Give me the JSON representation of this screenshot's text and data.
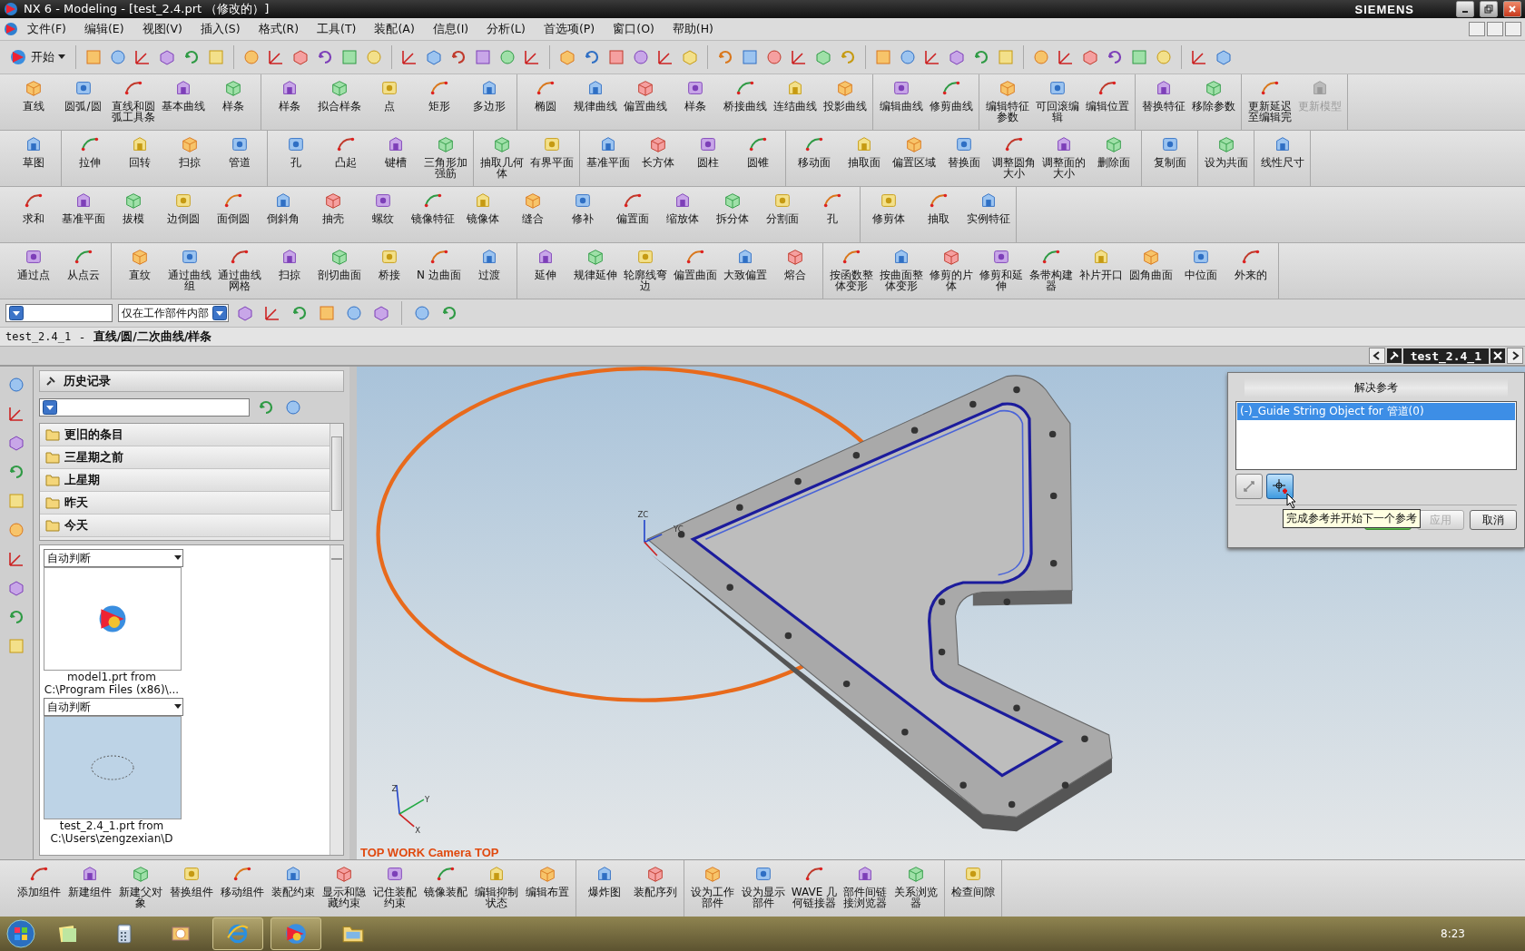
{
  "title_bar": {
    "title": "NX 6 - Modeling - [test_2.4.prt （修改的）]",
    "brand": "SIEMENS"
  },
  "menu": [
    "文件(F)",
    "编辑(E)",
    "视图(V)",
    "插入(S)",
    "格式(R)",
    "工具(T)",
    "装配(A)",
    "信息(I)",
    "分析(L)",
    "首选项(P)",
    "窗口(O)",
    "帮助(H)"
  ],
  "start_button": {
    "label": "开始"
  },
  "ribbon_rows": [
    [
      [
        {
          "label": "直线",
          "disabled": false
        },
        {
          "label": "圆弧/圆",
          "disabled": false
        },
        {
          "label": "直线和圆弧工具条",
          "disabled": false
        },
        {
          "label": "基本曲线",
          "disabled": false
        },
        {
          "label": "样条",
          "disabled": false
        }
      ],
      [
        {
          "label": "样条",
          "disabled": false
        },
        {
          "label": "拟合样条",
          "disabled": false
        },
        {
          "label": "点",
          "disabled": false
        },
        {
          "label": "矩形",
          "disabled": false
        },
        {
          "label": "多边形",
          "disabled": false
        }
      ],
      [
        {
          "label": "椭圆",
          "disabled": false
        },
        {
          "label": "规律曲线",
          "disabled": false
        },
        {
          "label": "偏置曲线",
          "disabled": false
        },
        {
          "label": "样条",
          "disabled": false
        },
        {
          "label": "桥接曲线",
          "disabled": false
        },
        {
          "label": "连结曲线",
          "disabled": false
        },
        {
          "label": "投影曲线",
          "disabled": false
        }
      ],
      [
        {
          "label": "编辑曲线",
          "disabled": false
        },
        {
          "label": "修剪曲线",
          "disabled": false
        }
      ],
      [
        {
          "label": "编辑特征参数",
          "disabled": false
        },
        {
          "label": "可回滚编辑",
          "disabled": false
        },
        {
          "label": "编辑位置",
          "disabled": false
        }
      ],
      [
        {
          "label": "替换特征",
          "disabled": false
        },
        {
          "label": "移除参数",
          "disabled": false
        }
      ],
      [
        {
          "label": "更新延迟至编辑完",
          "disabled": false
        },
        {
          "label": "更新模型",
          "disabled": true
        }
      ]
    ],
    [
      [
        {
          "label": "草图",
          "disabled": false
        }
      ],
      [
        {
          "label": "拉伸",
          "disabled": false
        },
        {
          "label": "回转",
          "disabled": false
        },
        {
          "label": "扫掠",
          "disabled": false
        },
        {
          "label": "管道",
          "disabled": false
        }
      ],
      [
        {
          "label": "孔",
          "disabled": false
        },
        {
          "label": "凸起",
          "disabled": false
        },
        {
          "label": "键槽",
          "disabled": false
        },
        {
          "label": "三角形加强筋",
          "disabled": false
        }
      ],
      [
        {
          "label": "抽取几何体",
          "disabled": false
        },
        {
          "label": "有界平面",
          "disabled": false
        }
      ],
      [
        {
          "label": "基准平面",
          "disabled": false
        },
        {
          "label": "长方体",
          "disabled": false
        },
        {
          "label": "圆柱",
          "disabled": false
        },
        {
          "label": "圆锥",
          "disabled": false
        }
      ],
      [
        {
          "label": "移动面",
          "disabled": false
        },
        {
          "label": "抽取面",
          "disabled": false
        },
        {
          "label": "偏置区域",
          "disabled": false
        },
        {
          "label": "替换面",
          "disabled": false
        },
        {
          "label": "调整圆角大小",
          "disabled": false
        },
        {
          "label": "调整面的大小",
          "disabled": false
        },
        {
          "label": "删除面",
          "disabled": false
        }
      ],
      [
        {
          "label": "复制面",
          "disabled": false
        }
      ],
      [
        {
          "label": "设为共面",
          "disabled": false
        }
      ],
      [
        {
          "label": "线性尺寸",
          "disabled": false
        }
      ]
    ],
    [
      [
        {
          "label": "求和",
          "disabled": false
        },
        {
          "label": "基准平面",
          "disabled": false
        },
        {
          "label": "拔模",
          "disabled": false
        },
        {
          "label": "边倒圆",
          "disabled": false
        },
        {
          "label": "面倒圆",
          "disabled": false
        },
        {
          "label": "倒斜角",
          "disabled": false
        },
        {
          "label": "抽壳",
          "disabled": false
        },
        {
          "label": "螺纹",
          "disabled": false
        },
        {
          "label": "镜像特征",
          "disabled": false
        },
        {
          "label": "镜像体",
          "disabled": false
        },
        {
          "label": "缝合",
          "disabled": false
        },
        {
          "label": "修补",
          "disabled": false
        },
        {
          "label": "偏置面",
          "disabled": false
        },
        {
          "label": "缩放体",
          "disabled": false
        },
        {
          "label": "拆分体",
          "disabled": false
        },
        {
          "label": "分割面",
          "disabled": false
        },
        {
          "label": "孔",
          "disabled": false
        }
      ],
      [
        {
          "label": "修剪体",
          "disabled": false
        },
        {
          "label": "抽取",
          "disabled": false
        },
        {
          "label": "实例特征",
          "disabled": false
        }
      ]
    ],
    [
      [
        {
          "label": "通过点",
          "disabled": false
        },
        {
          "label": "从点云",
          "disabled": false
        }
      ],
      [
        {
          "label": "直纹",
          "disabled": false
        },
        {
          "label": "通过曲线组",
          "disabled": false
        },
        {
          "label": "通过曲线网格",
          "disabled": false
        },
        {
          "label": "扫掠",
          "disabled": false
        },
        {
          "label": "剖切曲面",
          "disabled": false
        },
        {
          "label": "桥接",
          "disabled": false
        },
        {
          "label": "N 边曲面",
          "disabled": false
        },
        {
          "label": "过渡",
          "disabled": false
        }
      ],
      [
        {
          "label": "延伸",
          "disabled": false
        },
        {
          "label": "规律延伸",
          "disabled": false
        },
        {
          "label": "轮廓线弯边",
          "disabled": false
        },
        {
          "label": "偏置曲面",
          "disabled": false
        },
        {
          "label": "大致偏置",
          "disabled": false
        },
        {
          "label": "熔合",
          "disabled": false
        }
      ],
      [
        {
          "label": "按函数整体变形",
          "disabled": false
        },
        {
          "label": "按曲面整体变形",
          "disabled": false
        },
        {
          "label": "修剪的片体",
          "disabled": false
        },
        {
          "label": "修剪和延伸",
          "disabled": false
        },
        {
          "label": "条带构建器",
          "disabled": false
        },
        {
          "label": "补片开口",
          "disabled": false
        },
        {
          "label": "圆角曲面",
          "disabled": false
        },
        {
          "label": "中位面",
          "disabled": false
        },
        {
          "label": "外来的",
          "disabled": false
        }
      ]
    ]
  ],
  "selection_bar": {
    "scope": "仅在工作部件内部"
  },
  "cue_line": {
    "part": "test_2.4_1",
    "separator": "-",
    "prompt": "直线/圆/二次曲线/样条"
  },
  "window_tab": {
    "label": "test_2.4_1"
  },
  "navigator": {
    "title": "历史记录",
    "groups": [
      "更旧的条目",
      "三星期之前",
      "上星期",
      "昨天",
      "今天"
    ],
    "previews": [
      {
        "mode": "自动判断",
        "kind": "logo",
        "file": "model1.prt from",
        "path": "C:\\Program Files (x86)\\..."
      },
      {
        "mode": "自动判断",
        "kind": "sketch",
        "file": "test_2.4_1.prt from",
        "path": "C:\\Users\\zengzexian\\D"
      }
    ]
  },
  "graphics": {
    "view_label": "TOP WORK Camera TOP",
    "wcs_labels": [
      "ZC",
      "YC"
    ],
    "triad_labels": [
      "Z",
      "Y",
      "X"
    ]
  },
  "dialog": {
    "title": "解决参考",
    "items": [
      {
        "label": "(-)_Guide String Object for 管道(0)",
        "selected": true
      }
    ],
    "tools": [
      {
        "selected": false
      },
      {
        "selected": true
      }
    ],
    "buttons": [
      {
        "label": "应用",
        "disabled": true
      },
      {
        "label": "取消",
        "disabled": false
      }
    ],
    "tooltip": "完成参考并开始下一个参考"
  },
  "assembly_toolbar": [
    [
      "添加组件",
      "新建组件",
      "新建父对象",
      "替换组件",
      "移动组件",
      "装配约束",
      "显示和隐藏约束",
      "记住装配约束",
      "镜像装配",
      "编辑抑制状态",
      "编辑布置"
    ],
    [
      "爆炸图",
      "装配序列"
    ],
    [
      "设为工作部件",
      "设为显示部件",
      "WAVE 几何链接器",
      "部件间链接浏览器",
      "关系浏览器"
    ],
    [
      "检查间隙"
    ]
  ],
  "taskbar": {
    "time": "8:23",
    "apps": [
      {
        "kind": "notes",
        "selected": false
      },
      {
        "kind": "calculator",
        "selected": false
      },
      {
        "kind": "mail",
        "selected": false
      },
      {
        "kind": "browser",
        "selected": true
      },
      {
        "kind": "cad",
        "selected": true
      },
      {
        "kind": "folder",
        "selected": false
      }
    ]
  }
}
